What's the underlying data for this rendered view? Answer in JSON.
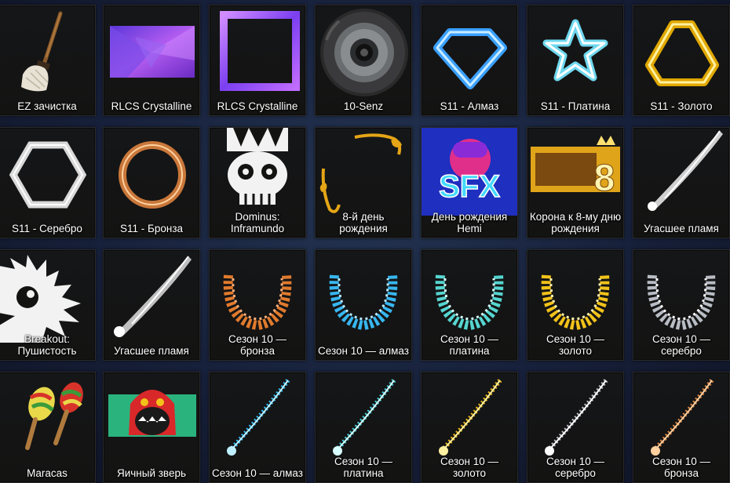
{
  "items": [
    {
      "label": "EZ зачистка",
      "icon": "broom-icon"
    },
    {
      "label": "RLCS Crystalline",
      "icon": "crystalline-decal-icon"
    },
    {
      "label": "RLCS Crystalline",
      "icon": "crystalline-frame-icon"
    },
    {
      "label": "10-Senz",
      "icon": "wheel-icon"
    },
    {
      "label": "S11 - Алмаз",
      "icon": "diamond-icon"
    },
    {
      "label": "S11 - Платина",
      "icon": "star-icon"
    },
    {
      "label": "S11 - Золото",
      "icon": "gold-triangle-icon"
    },
    {
      "label": "S11 - Серебро",
      "icon": "hexagon-icon"
    },
    {
      "label": "S11 - Бронза",
      "icon": "bronze-ring-icon"
    },
    {
      "label": "Dominus: Inframundo",
      "icon": "skull-mask-icon"
    },
    {
      "label": "8-й день рождения",
      "icon": "ornament-frame-icon"
    },
    {
      "label": "День рождения Hemi",
      "icon": "sfx-banner-icon"
    },
    {
      "label": "Корона к 8-му дню рождения",
      "icon": "crown-banner-icon"
    },
    {
      "label": "Угасшее пламя",
      "icon": "flame-streak-icon"
    },
    {
      "label": "Breakout: Пушистость",
      "icon": "fluffy-decal-icon"
    },
    {
      "label": "Угасшее пламя",
      "icon": "flame-streak-icon"
    },
    {
      "label": "Сезон 10 — бронза",
      "icon": "bronze-boost-ring-icon"
    },
    {
      "label": "Сезон 10 — алмаз",
      "icon": "diamond-boost-ring-icon"
    },
    {
      "label": "Сезон 10 — платина",
      "icon": "platinum-boost-ring-icon"
    },
    {
      "label": "Сезон 10 — золото",
      "icon": "gold-boost-ring-icon"
    },
    {
      "label": "Сезон 10 — серебро",
      "icon": "silver-boost-ring-icon"
    },
    {
      "label": "Maracas",
      "icon": "maracas-icon"
    },
    {
      "label": "Яичный зверь",
      "icon": "egg-beast-icon"
    },
    {
      "label": "Сезон 10 — алмаз",
      "icon": "diamond-trail-icon"
    },
    {
      "label": "Сезон 10 — платина",
      "icon": "platinum-trail-icon"
    },
    {
      "label": "Сезон 10 — золото",
      "icon": "gold-trail-icon"
    },
    {
      "label": "Сезон 10 — серебро",
      "icon": "silver-trail-icon"
    },
    {
      "label": "Сезон 10 — бронза",
      "icon": "bronze-trail-icon"
    }
  ],
  "colors": {
    "diamond": "#4fb8ff",
    "platinum": "#7fe3f5",
    "gold": "#f2c51a",
    "silver": "#c8c8d0",
    "bronze": "#d5803d"
  }
}
